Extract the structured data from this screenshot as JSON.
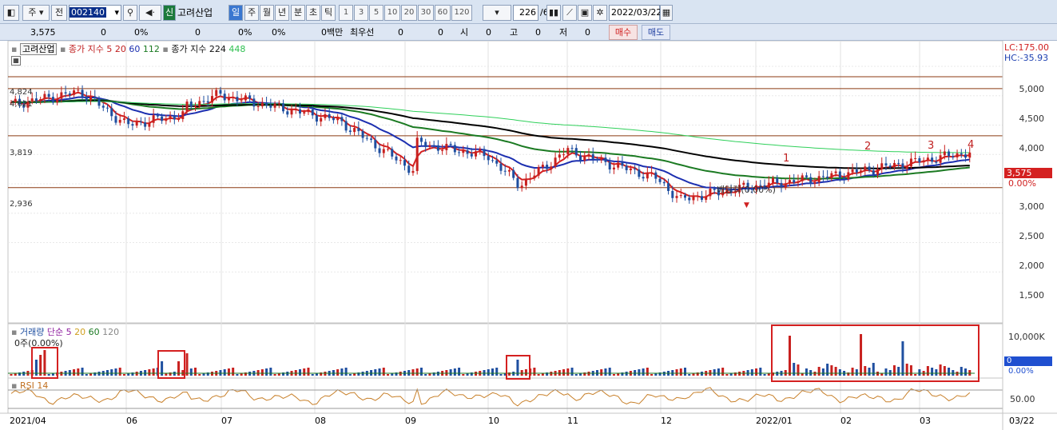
{
  "toolbar": {
    "period": "주",
    "prev": "전",
    "code": "002140",
    "shin": "신",
    "company": "고려산업",
    "tf_day": "일",
    "tf_week": "주",
    "tf_month": "월",
    "tf_year": "년",
    "tf_min": "분",
    "tf_sec": "초",
    "tf_tick": "틱",
    "intervals": [
      "1",
      "3",
      "5",
      "10",
      "20",
      "30",
      "60",
      "120"
    ],
    "count": "226",
    "count_total": "/600",
    "date": "2022/03/22"
  },
  "quote": {
    "price": "3,575",
    "v1": "0",
    "p1": "0%",
    "v2": "0",
    "p2": "0%",
    "p3": "0%",
    "unit": "0백만",
    "best": "최우선",
    "b1": "0",
    "b2": "0",
    "open_label": "시",
    "open": "0",
    "high_label": "고",
    "high": "0",
    "low_label": "저",
    "low": "0",
    "buy": "매수",
    "sell": "매도"
  },
  "price_legend": {
    "stock": "고려산업",
    "ma_label": "종가 지수 5",
    "ma20": "20",
    "ma60": "60",
    "ma112": "112",
    "ma2_label": "종가 지수 224",
    "ma448": "448"
  },
  "right_info": {
    "lc": "LC:175.00",
    "hc": "HC:-35.93"
  },
  "price_axis": [
    "5,000",
    "4,500",
    "4,000",
    "3,500",
    "3,000",
    "2,500",
    "2,000",
    "1,500"
  ],
  "levels": [
    "4,824",
    "4,621",
    "3,819",
    "2,936"
  ],
  "current_price": "3,575",
  "current_pct": "0.00%",
  "annotations": {
    "n1": "1",
    "n2": "2",
    "n3": "3",
    "n4": "4",
    "dividend": "배당락(0.00%)"
  },
  "volume_legend": {
    "label": "거래량",
    "type": "단순 5",
    "ma20": "20",
    "ma60": "60",
    "ma120": "120",
    "value": "0주(0.00%)"
  },
  "volume_axis": {
    "top": "10,000K",
    "cur": "0",
    "pct": "0.00%"
  },
  "rsi": {
    "label": "RSI 14",
    "axis": "50.00"
  },
  "x_axis": [
    "2021/04",
    "06",
    "07",
    "08",
    "09",
    "10",
    "11",
    "12",
    "2022/01",
    "02",
    "03"
  ],
  "x_end": "03/22",
  "colors": {
    "up": "#c8201e",
    "down": "#1f4fa0",
    "ma5": "#d42020",
    "ma20": "#1c2fb0",
    "ma60": "#1b7a22",
    "ma112": "#000000",
    "ma448": "#2fd05a",
    "level": "#8b3a12",
    "box": "#d42020"
  }
}
